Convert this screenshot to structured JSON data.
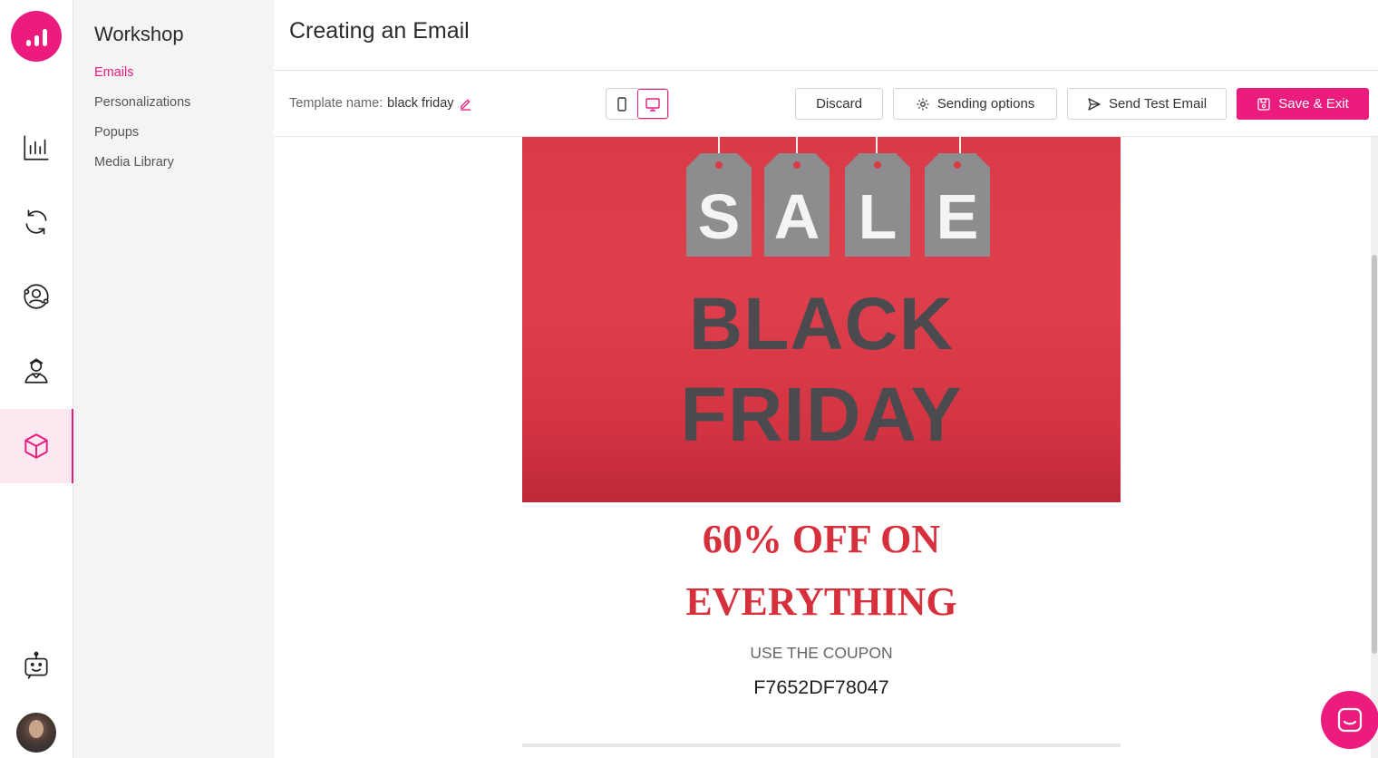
{
  "rail": {
    "items": [
      {
        "icon": "analytics-icon"
      },
      {
        "icon": "sync-icon"
      },
      {
        "icon": "audience-icon"
      },
      {
        "icon": "visitor-icon"
      },
      {
        "icon": "workshop-box-icon",
        "active": true
      }
    ],
    "bot_icon": "bot-icon",
    "accent": "#ec1c7e"
  },
  "subnav": {
    "title": "Workshop",
    "items": [
      {
        "label": "Emails",
        "active": true
      },
      {
        "label": "Personalizations"
      },
      {
        "label": "Popups"
      },
      {
        "label": "Media Library"
      }
    ]
  },
  "header": {
    "title": "Creating an Email"
  },
  "toolbar": {
    "template_label": "Template name:",
    "template_value": "black friday",
    "device_modes": [
      "mobile",
      "desktop"
    ],
    "active_device": "desktop",
    "discard_label": "Discard",
    "sending_options_label": "Sending options",
    "send_test_label": "Send Test Email",
    "save_exit_label": "Save & Exit"
  },
  "email": {
    "hero_tags": [
      "S",
      "A",
      "L",
      "E"
    ],
    "hero_line1": "BLACK",
    "hero_line2": "FRIDAY",
    "offer_line1": "60% OFF ON",
    "offer_line2": "EVERYTHING",
    "coupon_label": "USE THE COUPON",
    "coupon_code": "F7652DF78047",
    "offer_color": "#d7303d",
    "hero_color": "#d83b47"
  }
}
